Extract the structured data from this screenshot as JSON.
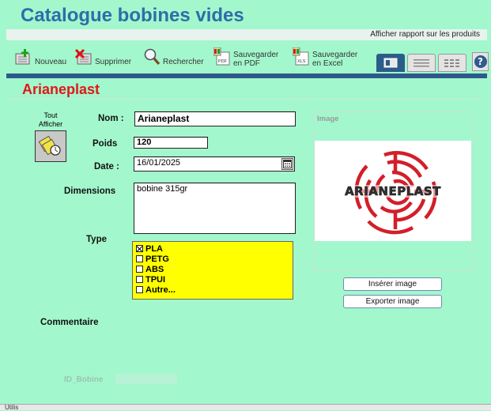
{
  "window": {
    "title": "Catalogue bobines vides",
    "report_link": "Afficher rapport sur les produits"
  },
  "toolbar": {
    "nouveau": "Nouveau",
    "supprimer": "Supprimer",
    "rechercher": "Rechercher",
    "pdf_line1": "Sauvegarder",
    "pdf_line2": "en PDF",
    "excel_line1": "Sauvegarder",
    "excel_line2": "en Excel",
    "help": "?",
    "pdf_icon_text": "PDF",
    "xls_icon_text": "XLS"
  },
  "record": {
    "title": "Arianeplast",
    "tout_afficher_line1": "Tout",
    "tout_afficher_line2": "Afficher",
    "nom_label": "Nom :",
    "nom_value": "Arianeplast",
    "poids_label": "Poids",
    "poids_value": "120",
    "date_label": "Date :",
    "date_value": "16/01/2025",
    "dimensions_label": "Dimensions",
    "dimensions_value": "bobine 315gr",
    "type_label": "Type",
    "types": [
      {
        "label": "PLA",
        "checked": true
      },
      {
        "label": "PETG",
        "checked": false
      },
      {
        "label": "ABS",
        "checked": false
      },
      {
        "label": "TPUI",
        "checked": false
      },
      {
        "label": "Autre...",
        "checked": false
      }
    ],
    "image_label": "Image",
    "logo_text": "ARIANEPLAST",
    "insert_image": "Insérer image",
    "export_image": "Exporter image",
    "commentaire_label": "Commentaire",
    "id_label": "ID_Bobine"
  },
  "status_bar": {
    "text": "Utilis"
  },
  "colors": {
    "background": "#a3f7cd",
    "title": "#2d6ea8",
    "record_title": "#e01818",
    "type_highlight": "#ffff00",
    "bar": "#2c5a8a"
  }
}
